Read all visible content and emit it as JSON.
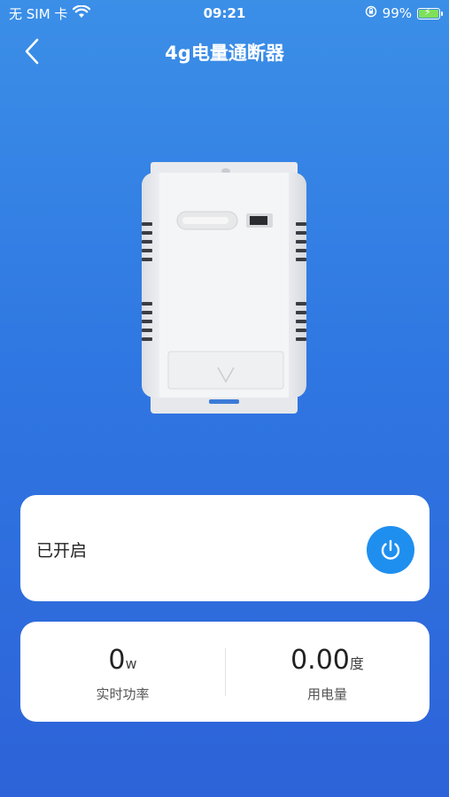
{
  "status_bar": {
    "carrier": "无 SIM 卡",
    "time": "09:21",
    "battery": "99%"
  },
  "nav": {
    "title": "4g电量通断器"
  },
  "switch": {
    "label": "已开启",
    "state_on": true
  },
  "stats": {
    "power": {
      "value": "0",
      "unit": "w",
      "label": "实时功率"
    },
    "energy": {
      "value": "0.00",
      "unit": "度",
      "label": "用电量"
    }
  },
  "colors": {
    "background_top": "#3b8fe7",
    "background_bottom": "#2d63d8",
    "power_button": "#1f8fef",
    "card": "#ffffff"
  },
  "icons": [
    "wifi-icon",
    "orientation-lock-icon",
    "battery-icon",
    "back-chevron-icon",
    "power-icon"
  ]
}
